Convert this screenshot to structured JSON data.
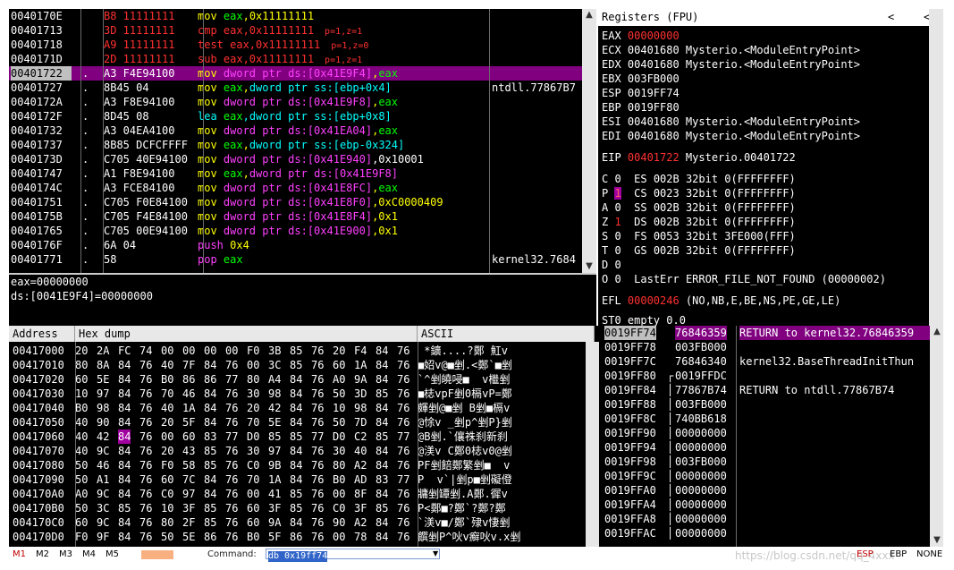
{
  "disassembly": {
    "rows": [
      {
        "addr": "0040170E",
        "mark": "",
        "hex": "B8 11111111",
        "asm": [
          {
            "t": "mov ",
            "c": "#ffff00"
          },
          {
            "t": "eax",
            "c": "#00ff00"
          },
          {
            "t": ",0x11111111",
            "c": "#ffff00"
          }
        ],
        "note": "",
        "cmt": "",
        "hl": false,
        "hexColor": "#ff3030",
        "asmBg": ""
      },
      {
        "addr": "00401713",
        "mark": "",
        "hex": "3D 11111111",
        "asm": [
          {
            "t": "cmp eax,0x11111111",
            "c": "#ff3030"
          }
        ],
        "note": "p=1,z=1",
        "cmt": "",
        "hl": false,
        "hexColor": "#ff3030",
        "asmBg": ""
      },
      {
        "addr": "00401718",
        "mark": "",
        "hex": "A9 11111111",
        "asm": [
          {
            "t": "test eax,0x11111111",
            "c": "#ff3030"
          }
        ],
        "note": "p=1,z=0",
        "cmt": "",
        "hl": false,
        "hexColor": "#ff3030",
        "asmBg": ""
      },
      {
        "addr": "0040171D",
        "mark": "",
        "hex": "2D 11111111",
        "asm": [
          {
            "t": "sub eax,0x11111111",
            "c": "#ff3030"
          }
        ],
        "note": "p=1,z=1",
        "cmt": "",
        "hl": false,
        "hexColor": "#ff3030",
        "asmBg": ""
      },
      {
        "addr": "00401722",
        "mark": ".",
        "hex": "A3 F4E94100",
        "asm": [
          {
            "t": "mov ",
            "c": "#ffff00"
          },
          {
            "t": "dword ptr ds:[0x41E9F4]",
            "c": "#ff40ff"
          },
          {
            "t": ",",
            "c": "#ffff00"
          },
          {
            "t": "eax",
            "c": "#00ff00"
          }
        ],
        "note": "",
        "cmt": "",
        "hl": true,
        "hexColor": "#ffffff",
        "asmBg": ""
      },
      {
        "addr": "00401727",
        "mark": ".",
        "hex": "8B45 04",
        "asm": [
          {
            "t": "mov ",
            "c": "#ffff00"
          },
          {
            "t": "eax",
            "c": "#00ff00"
          },
          {
            "t": ",",
            "c": "#ffff00"
          },
          {
            "t": "dword ptr ss:[ebp+0x4]",
            "c": "#00ffff"
          }
        ],
        "note": "",
        "cmt": "ntdll.77867B7",
        "hl": false,
        "hexColor": "#ffffff",
        "asmBg": ""
      },
      {
        "addr": "0040172A",
        "mark": ".",
        "hex": "A3 F8E94100",
        "asm": [
          {
            "t": "mov ",
            "c": "#ffff00"
          },
          {
            "t": "dword ptr ds:[0x41E9F8]",
            "c": "#ff40ff"
          },
          {
            "t": ",",
            "c": "#ffff00"
          },
          {
            "t": "eax",
            "c": "#00ff00"
          }
        ],
        "note": "",
        "cmt": "",
        "hl": false,
        "hexColor": "#ffffff",
        "asmBg": ""
      },
      {
        "addr": "0040172F",
        "mark": ".",
        "hex": "8D45 08",
        "asm": [
          {
            "t": "lea ",
            "c": "#00ffff"
          },
          {
            "t": "eax",
            "c": "#00ff00"
          },
          {
            "t": ",",
            "c": "#00ffff"
          },
          {
            "t": "dword ptr ss:[ebp+0x8]",
            "c": "#00ffff"
          }
        ],
        "note": "",
        "cmt": "",
        "hl": false,
        "hexColor": "#ffffff",
        "asmBg": ""
      },
      {
        "addr": "00401732",
        "mark": ".",
        "hex": "A3 04EA4100",
        "asm": [
          {
            "t": "mov ",
            "c": "#ffff00"
          },
          {
            "t": "dword ptr ds:[0x41EA04]",
            "c": "#ff40ff"
          },
          {
            "t": ",",
            "c": "#ffff00"
          },
          {
            "t": "eax",
            "c": "#00ff00"
          }
        ],
        "note": "",
        "cmt": "",
        "hl": false,
        "hexColor": "#ffffff",
        "asmBg": ""
      },
      {
        "addr": "00401737",
        "mark": ".",
        "hex": "8B85 DCFCFFFF",
        "asm": [
          {
            "t": "mov ",
            "c": "#ffff00"
          },
          {
            "t": "eax",
            "c": "#00ff00"
          },
          {
            "t": ",",
            "c": "#ffff00"
          },
          {
            "t": "dword ptr ss:[ebp-0x324]",
            "c": "#00ffff"
          }
        ],
        "note": "",
        "cmt": "",
        "hl": false,
        "hexColor": "#ffffff",
        "asmBg": ""
      },
      {
        "addr": "0040173D",
        "mark": ".",
        "hex": "C705 40E94100",
        "asm": [
          {
            "t": "mov ",
            "c": "#ffff00"
          },
          {
            "t": "dword ptr ds:[0x41E940]",
            "c": "#ff40ff"
          },
          {
            "t": ",0x10001",
            "c": "#ffffff"
          }
        ],
        "note": "",
        "cmt": "",
        "hl": false,
        "hexColor": "#ffffff",
        "asmBg": ""
      },
      {
        "addr": "00401747",
        "mark": ".",
        "hex": "A1 F8E94100",
        "asm": [
          {
            "t": "mov ",
            "c": "#ffff00"
          },
          {
            "t": "eax",
            "c": "#00ff00"
          },
          {
            "t": ",",
            "c": "#ffff00"
          },
          {
            "t": "dword ptr ds:[0x41E9F8]",
            "c": "#ff40ff"
          }
        ],
        "note": "",
        "cmt": "",
        "hl": false,
        "hexColor": "#ffffff",
        "asmBg": ""
      },
      {
        "addr": "0040174C",
        "mark": ".",
        "hex": "A3 FCE84100",
        "asm": [
          {
            "t": "mov ",
            "c": "#ffff00"
          },
          {
            "t": "dword ptr ds:[0x41E8FC]",
            "c": "#ff40ff"
          },
          {
            "t": ",",
            "c": "#ffff00"
          },
          {
            "t": "eax",
            "c": "#00ff00"
          }
        ],
        "note": "",
        "cmt": "",
        "hl": false,
        "hexColor": "#ffffff",
        "asmBg": ""
      },
      {
        "addr": "00401751",
        "mark": ".",
        "hex": "C705 F0E84100",
        "asm": [
          {
            "t": "mov ",
            "c": "#ffff00"
          },
          {
            "t": "dword ptr ds:[0x41E8F0]",
            "c": "#ff40ff"
          },
          {
            "t": ",0xC0000409",
            "c": "#ffff00"
          }
        ],
        "note": "",
        "cmt": "",
        "hl": false,
        "hexColor": "#ffffff",
        "asmBg": ""
      },
      {
        "addr": "0040175B",
        "mark": ".",
        "hex": "C705 F4E84100",
        "asm": [
          {
            "t": "mov ",
            "c": "#ffff00"
          },
          {
            "t": "dword ptr ds:[0x41E8F4]",
            "c": "#ff40ff"
          },
          {
            "t": ",0x1",
            "c": "#ffff00"
          }
        ],
        "note": "",
        "cmt": "",
        "hl": false,
        "hexColor": "#ffffff",
        "asmBg": ""
      },
      {
        "addr": "00401765",
        "mark": ".",
        "hex": "C705 00E94100",
        "asm": [
          {
            "t": "mov ",
            "c": "#ffff00"
          },
          {
            "t": "dword ptr ds:[0x41E900]",
            "c": "#ff40ff"
          },
          {
            "t": ",0x1",
            "c": "#ffff00"
          }
        ],
        "note": "",
        "cmt": "",
        "hl": false,
        "hexColor": "#ffffff",
        "asmBg": ""
      },
      {
        "addr": "0040176F",
        "mark": ".",
        "hex": "6A 04",
        "asm": [
          {
            "t": "push ",
            "c": "#ff40ff"
          },
          {
            "t": "0x4",
            "c": "#ffff00"
          }
        ],
        "note": "",
        "cmt": "",
        "hl": false,
        "hexColor": "#ffffff",
        "asmBg": ""
      },
      {
        "addr": "00401771",
        "mark": ".",
        "hex": "58",
        "asm": [
          {
            "t": "pop ",
            "c": "#ff40ff"
          },
          {
            "t": "eax",
            "c": "#00ff00"
          }
        ],
        "note": "",
        "cmt": "kernel32.7684",
        "hl": false,
        "hexColor": "#ffffff",
        "asmBg": ""
      }
    ]
  },
  "info": {
    "line1": "eax=00000000",
    "line2": "ds:[0041E9F4]=00000000"
  },
  "registers": {
    "title": "Registers (FPU)",
    "rows": [
      {
        "label": "EAX ",
        "value": "00000000",
        "cmt": "",
        "red": true
      },
      {
        "label": "ECX ",
        "value": "00401680",
        "cmt": " Mysterio.<ModuleEntryPoint>",
        "red": false
      },
      {
        "label": "EDX ",
        "value": "00401680",
        "cmt": " Mysterio.<ModuleEntryPoint>",
        "red": false
      },
      {
        "label": "EBX ",
        "value": "003FB000",
        "cmt": "",
        "red": false
      },
      {
        "label": "ESP ",
        "value": "0019FF74",
        "cmt": "",
        "red": false
      },
      {
        "label": "EBP ",
        "value": "0019FF80",
        "cmt": "",
        "red": false
      },
      {
        "label": "ESI ",
        "value": "00401680",
        "cmt": " Mysterio.<ModuleEntryPoint>",
        "red": false
      },
      {
        "label": "EDI ",
        "value": "00401680",
        "cmt": " Mysterio.<ModuleEntryPoint>",
        "red": false
      }
    ],
    "eip": {
      "label": "EIP ",
      "value": "00401722",
      "cmt": " Mysterio.00401722"
    },
    "flags": [
      {
        "f": "C",
        "v": "0",
        "seg": "ES 002B 32bit 0(FFFFFFFF)",
        "mode": "plain"
      },
      {
        "f": "P",
        "v": "1",
        "seg": "CS 0023 32bit 0(FFFFFFFF)",
        "mode": "box"
      },
      {
        "f": "A",
        "v": "0",
        "seg": "SS 002B 32bit 0(FFFFFFFF)",
        "mode": "plain"
      },
      {
        "f": "Z",
        "v": "1",
        "seg": "DS 002B 32bit 0(FFFFFFFF)",
        "mode": "red"
      },
      {
        "f": "S",
        "v": "0",
        "seg": "FS 0053 32bit 3FE000(FFF)",
        "mode": "plain"
      },
      {
        "f": "T",
        "v": "0",
        "seg": "GS 002B 32bit 0(FFFFFFFF)",
        "mode": "plain"
      },
      {
        "f": "D",
        "v": "0",
        "seg": "",
        "mode": "plain"
      },
      {
        "f": "O",
        "v": "0",
        "seg": "LastErr ERROR_FILE_NOT_FOUND (00000002)",
        "mode": "plain"
      }
    ],
    "efl": {
      "label": "EFL ",
      "value": "00000246",
      "cmt": " (NO,NB,E,BE,NS,PE,GE,LE)"
    },
    "st0": "ST0 empty 0.0"
  },
  "dump": {
    "headers": {
      "address": "Address",
      "hex": "Hex dump",
      "ascii": "ASCII"
    },
    "rows": [
      {
        "addr": "00417000",
        "hex": [
          "20",
          "2A",
          "FC",
          "74",
          "00",
          "00",
          "00",
          "00",
          "F0",
          "3B",
          "85",
          "76",
          "20",
          "F4",
          "84",
          "76"
        ],
        "ascii": " *鑛....?鄭 魟v"
      },
      {
        "addr": "00417010",
        "hex": [
          "80",
          "8A",
          "84",
          "76",
          "40",
          "7F",
          "84",
          "76",
          "00",
          "3C",
          "85",
          "76",
          "60",
          "1A",
          "84",
          "76"
        ],
        "ascii": "■妱v@■剉.<鄭`■剉"
      },
      {
        "addr": "00417020",
        "hex": [
          "60",
          "5E",
          "84",
          "76",
          "B0",
          "86",
          "86",
          "77",
          "80",
          "A4",
          "84",
          "76",
          "A0",
          "9A",
          "84",
          "76"
        ],
        "ascii": "`^剉皢唚■  v檵剉"
      },
      {
        "addr": "00417030",
        "hex": [
          "10",
          "97",
          "84",
          "76",
          "70",
          "46",
          "84",
          "76",
          "30",
          "98",
          "84",
          "76",
          "50",
          "3D",
          "85",
          "76"
        ],
        "ascii": "■梽vpF剉0槅vP=鄭"
      },
      {
        "addr": "00417040",
        "hex": [
          "B0",
          "98",
          "84",
          "76",
          "40",
          "1A",
          "84",
          "76",
          "20",
          "42",
          "84",
          "76",
          "10",
          "98",
          "84",
          "76"
        ],
        "ascii": "皹剉@■剉 B剉■槅v"
      },
      {
        "addr": "00417050",
        "hex": [
          "40",
          "90",
          "84",
          "76",
          "20",
          "5F",
          "84",
          "76",
          "70",
          "5E",
          "84",
          "76",
          "50",
          "7D",
          "84",
          "76"
        ],
        "ascii": "@悇v _剉p^剉P}剉"
      },
      {
        "addr": "00417060",
        "hex": [
          "40",
          "42",
          "84",
          "76",
          "00",
          "60",
          "83",
          "77",
          "D0",
          "85",
          "85",
          "77",
          "D0",
          "C2",
          "85",
          "77"
        ],
        "ascii": "@B剉.`儴祩刹新刹"
      },
      {
        "addr": "00417070",
        "hex": [
          "40",
          "9C",
          "84",
          "76",
          "20",
          "43",
          "85",
          "76",
          "30",
          "97",
          "84",
          "76",
          "30",
          "40",
          "84",
          "76"
        ],
        "ascii": "@渼v C鄭0梽v0@剉"
      },
      {
        "addr": "00417080",
        "hex": [
          "50",
          "46",
          "84",
          "76",
          "F0",
          "58",
          "85",
          "76",
          "C0",
          "9B",
          "84",
          "76",
          "80",
          "A2",
          "84",
          "76"
        ],
        "ascii": "PF剉餢鄭繁剉■  v"
      },
      {
        "addr": "00417090",
        "hex": [
          "50",
          "A1",
          "84",
          "76",
          "60",
          "7C",
          "84",
          "76",
          "70",
          "1A",
          "84",
          "76",
          "B0",
          "AD",
          "83",
          "77"
        ],
        "ascii": "P  v`|剉p■剉礙僜"
      },
      {
        "addr": "004170A0",
        "hex": [
          "A0",
          "9C",
          "84",
          "76",
          "C0",
          "97",
          "84",
          "76",
          "00",
          "41",
          "85",
          "76",
          "00",
          "8F",
          "84",
          "76"
        ],
        "ascii": "牅剉罈剉.A鄭.徲v"
      },
      {
        "addr": "004170B0",
        "hex": [
          "50",
          "3C",
          "85",
          "76",
          "10",
          "3F",
          "85",
          "76",
          "60",
          "3F",
          "85",
          "76",
          "C0",
          "3F",
          "85",
          "76"
        ],
        "ascii": "P<鄭■?鄭`?鄭?鄭"
      },
      {
        "addr": "004170C0",
        "hex": [
          "60",
          "9C",
          "84",
          "76",
          "80",
          "2F",
          "85",
          "76",
          "60",
          "9A",
          "84",
          "76",
          "90",
          "A2",
          "84",
          "76"
        ],
        "ascii": "`渼v■/鄭`殔v悽剉"
      },
      {
        "addr": "004170D0",
        "hex": [
          "F0",
          "9F",
          "84",
          "76",
          "50",
          "5E",
          "86",
          "76",
          "B0",
          "5F",
          "86",
          "76",
          "00",
          "78",
          "84",
          "76"
        ],
        "ascii": "饌剉P^吙v癬吙v.x剉"
      }
    ],
    "highlight": {
      "row": 6,
      "col": 2
    }
  },
  "stack": {
    "rows": [
      {
        "addr": "0019FF74",
        "val": "76846359",
        "cmt": "RETURN to kernel32.76846359",
        "hl": true,
        "br": ""
      },
      {
        "addr": "0019FF78",
        "val": "003FB000",
        "cmt": "",
        "hl": false,
        "br": ""
      },
      {
        "addr": "0019FF7C",
        "val": "76846340",
        "cmt": "kernel32.BaseThreadInitThun",
        "hl": false,
        "br": ""
      },
      {
        "addr": "0019FF80",
        "val": "0019FFDC",
        "cmt": "",
        "hl": false,
        "br": "┌"
      },
      {
        "addr": "0019FF84",
        "val": "77867B74",
        "cmt": "RETURN to ntdll.77867B74",
        "hl": false,
        "br": "│"
      },
      {
        "addr": "0019FF88",
        "val": "003FB000",
        "cmt": "",
        "hl": false,
        "br": "│"
      },
      {
        "addr": "0019FF8C",
        "val": "740BB618",
        "cmt": "",
        "hl": false,
        "br": "│"
      },
      {
        "addr": "0019FF90",
        "val": "00000000",
        "cmt": "",
        "hl": false,
        "br": "│"
      },
      {
        "addr": "0019FF94",
        "val": "00000000",
        "cmt": "",
        "hl": false,
        "br": "│"
      },
      {
        "addr": "0019FF98",
        "val": "003FB000",
        "cmt": "",
        "hl": false,
        "br": "│"
      },
      {
        "addr": "0019FF9C",
        "val": "00000000",
        "cmt": "",
        "hl": false,
        "br": "│"
      },
      {
        "addr": "0019FFA0",
        "val": "00000000",
        "cmt": "",
        "hl": false,
        "br": "│"
      },
      {
        "addr": "0019FFA4",
        "val": "00000000",
        "cmt": "",
        "hl": false,
        "br": "│"
      },
      {
        "addr": "0019FFA8",
        "val": "00000000",
        "cmt": "",
        "hl": false,
        "br": "│"
      },
      {
        "addr": "0019FFAC",
        "val": "00000000",
        "cmt": "",
        "hl": false,
        "br": "│"
      }
    ]
  },
  "bottom": {
    "mem_buttons": [
      "M1",
      "M2",
      "M3",
      "M4",
      "M5"
    ],
    "command_label": "Command:",
    "command_value": "db 0x19ff74",
    "status": [
      "ESP",
      "EBP",
      "NONE"
    ],
    "watermark": "https://blog.csdn.net/qq_4xxx"
  },
  "icons": {
    "scroll_up": "triangle-up",
    "scroll_down": "triangle-down",
    "nav_left": "chevron-left"
  },
  "colors": {
    "highlight": "#a000a0",
    "background": "#000000",
    "red": "#ff3030"
  }
}
